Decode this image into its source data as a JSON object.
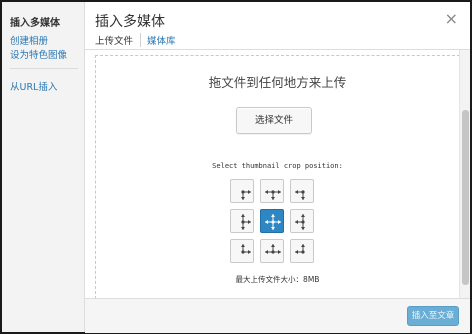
{
  "sidebar": {
    "title": "插入多媒体",
    "links": [
      "创建相册",
      "设为特色图像",
      "从URL插入"
    ]
  },
  "header": {
    "title": "插入多媒体",
    "close_icon": "close-icon",
    "tabs": [
      "上传文件",
      "媒体库"
    ]
  },
  "upload": {
    "drop_text": "拖文件到任何地方来上传",
    "select_button": "选择文件",
    "crop_label": "Select thumbnail crop position:",
    "crop_selected": "center",
    "max_size": "最大上传文件大小：8MB"
  },
  "footer": {
    "insert_button": "插入至文章"
  },
  "colors": {
    "link": "#2a78b4",
    "active_cell": "#2e87c3",
    "insert_button": "#6aaed6"
  }
}
